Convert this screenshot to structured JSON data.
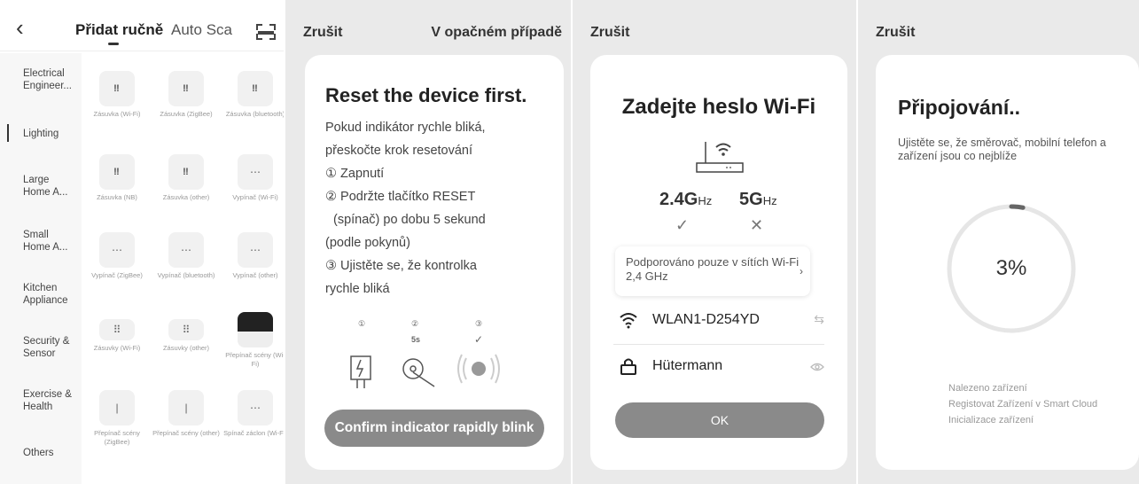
{
  "panel1": {
    "tab_manual": "Přidat ručně",
    "tab_auto": "Auto Sca",
    "categories": [
      "Electrical Engineer...",
      "Lighting",
      "Large Home A...",
      "Small Home A...",
      "Kitchen Appliance",
      "Security & Sensor",
      "Exercise & Health",
      "Others"
    ],
    "devices": [
      "Zásuvka (Wi-Fi)",
      "Zásuvka (ZigBee)",
      "Zásuvka (bluetooth)",
      "Zásuvka (NB)",
      "Zásuvka (other)",
      "Vypínač (Wi-Fi)",
      "Vypínač (ZigBee)",
      "Vypínač (bluetooth)",
      "Vypínač (other)",
      "Zásuvky (Wi-Fi)",
      "Zásuvky (other)",
      "Přepínač scény (Wi-Fi)",
      "Přepínač scény (ZigBee)",
      "Přepínač scény (other)",
      "Spínač záclon (Wi-Fi)"
    ]
  },
  "panel2": {
    "cancel": "Zrušit",
    "other": "V opačném případě",
    "title": "Reset the device first.",
    "lines": [
      "Pokud indikátor rychle bliká,",
      "přeskočte krok resetování",
      "① Zapnutí",
      "② Podržte tlačítko RESET",
      "(spínač)   po dobu 5 sekund",
      "(podle pokynů)",
      "③ Ujistěte se, že kontrolka",
      "rychle bliká"
    ],
    "step_nums": [
      "①",
      "②",
      "③"
    ],
    "step_time": "5s",
    "confirm": "Confirm indicator rapidly blink"
  },
  "panel3": {
    "cancel": "Zrušit",
    "title": "Zadejte heslo Wi-Fi",
    "band24": "2.4G",
    "band5": "5G",
    "hz": "Hz",
    "mark24": "✓",
    "mark5": "✕",
    "notice": "Podporováno pouze v sítích Wi-Fi 2,4 GHz",
    "ssid": "WLAN1-D254YD",
    "password": "Hütermann",
    "ok": "OK"
  },
  "panel4": {
    "cancel": "Zrušit",
    "title": "Připojování..",
    "subtitle": "Ujistěte se, že směrovač, mobilní telefon a zařízení jsou co nejblíže",
    "progress_pct": 3,
    "progress_label": "3%",
    "statuses": [
      "Nalezeno zařízení",
      "Registovat Zařízení  v Smart Cloud",
      "Inicializace zařízení"
    ]
  }
}
